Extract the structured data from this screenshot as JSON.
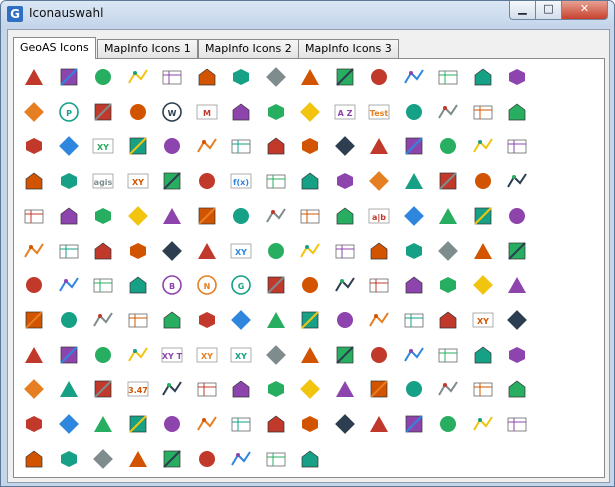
{
  "window": {
    "title": "Iconauswahl",
    "minimize_glyph": "▁",
    "maximize_glyph": "□",
    "close_glyph": "✕",
    "logo_text": "G"
  },
  "tabs": [
    {
      "label": "GeoAS Icons",
      "active": true
    },
    {
      "label": "MapInfo Icons 1",
      "active": false
    },
    {
      "label": "MapInfo Icons 2",
      "active": false
    },
    {
      "label": "MapInfo Icons 3",
      "active": false
    }
  ],
  "icon_texts": {
    "test": "Test",
    "agis": "agis",
    "fx": "f(x)",
    "ab": "a|b",
    "xy": "XY",
    "xyt": "XY T",
    "num347": "3.47",
    "az": "A Z",
    "m": "M",
    "w": "W",
    "b": "B",
    "n": "N",
    "g": "G",
    "p": "P"
  },
  "icons": [
    [
      "triangle-red",
      "chevron-blue",
      "box-green",
      "house-green",
      "pipe-yellow",
      "table-numbers",
      "angle-red",
      "cross-lines",
      "layers-gray",
      "pencil-box",
      "columns-box",
      "node-red",
      "doc-lines",
      "folder-magnify",
      "magnify-doc"
    ],
    [
      "checkmark",
      "circle-p",
      "shapes",
      "hatch-green",
      "circle-w",
      "mini-table",
      "fold-gray",
      "record-red",
      "target-red",
      "az-sort",
      "test-label",
      "grid-photo",
      "node-grid",
      "flag-red",
      "flag-red-right"
    ],
    [
      "flag-down",
      "angle-blue",
      "xy-angle",
      "grid-yellow",
      "move-yellow",
      "move-arrows",
      "node-move",
      "stamp",
      "line-yellow",
      "gradient-green",
      "arrow-blue",
      "logo-g",
      "line-dots",
      "dotted-box",
      "disk-blue"
    ],
    [
      "glasses",
      "wi-logo",
      "agis-label",
      "grid-xy",
      "scissors",
      "scissors-house",
      "fx-label",
      "table-calc",
      "target-orange",
      "no-target",
      "gradient-box",
      "cross-red",
      "cross-green",
      "cross-blue",
      "brush-orange"
    ],
    [
      "blob-green",
      "blob-orange",
      "copy-box",
      "arrow-box",
      "axes",
      "circle-green",
      "line-dotted",
      "curve",
      "cross-box",
      "triangle-yellow",
      "ab-box",
      "angle-plain",
      "house-yellow",
      "hash-grid",
      "question-house"
    ],
    [
      "wrench-blue",
      "map-yellow",
      "brush-blue",
      "brush-yellow",
      "scissors-blue",
      "mountain-green",
      "xy-red",
      "disk-line",
      "line-up",
      "arrow-circle",
      "smiley",
      "pencil-yellow",
      "plus-box",
      "grid-lines",
      "user-green"
    ],
    [
      "envelope",
      "magnify",
      "excel-green",
      "line-edit",
      "circle-b",
      "circle-n",
      "circle-g",
      "line-red",
      "line-node",
      "house-up",
      "house-cross",
      "house-line",
      "arrows-in",
      "arrows-out",
      "square-select"
    ],
    [
      "line-up-blue",
      "road-icon",
      "barrier-red",
      "cylinder",
      "arrow-green",
      "polygon-yellow",
      "star-black",
      "film",
      "x-red",
      "hand",
      "box-refresh",
      "box-refresh2",
      "box-refresh3",
      "xy-circle",
      "chart-bars"
    ],
    [
      "rotate-box",
      "google-logo",
      "wave-blue",
      "funnel",
      "xyt-label",
      "xy-line",
      "xy-axis",
      "diamond-orange",
      "gradient-teal",
      "scissors-line",
      "road-gray",
      "refresh-blue",
      "red-shape",
      "diamond-green",
      "x-box-red"
    ],
    [
      "arrow-down-yellow",
      "arrow-up-yellow",
      "axes-x",
      "num-label",
      "folder-edit",
      "disk-folder",
      "door-green",
      "globe-blue",
      "folder-tools",
      "folder-export",
      "door-red",
      "stack-layers",
      "folder-yellow",
      "globe-hand",
      "wrench-folder"
    ],
    [
      "flag-golf",
      "arrow-right-box",
      "green-arrow-box",
      "arrow-left-box",
      "globe-gray",
      "table-box",
      "doc-list",
      "doc-cols",
      "loop-arrows",
      "gears",
      "scissors-folder",
      "disk-record",
      "magnify-box",
      "chart-doc",
      "book-open"
    ],
    [
      "trash-can",
      "folder-arrow",
      "map-pale",
      "map-small",
      "map-green",
      "map-blue",
      "doc-grid",
      "folder-delete",
      "folder-add"
    ]
  ]
}
